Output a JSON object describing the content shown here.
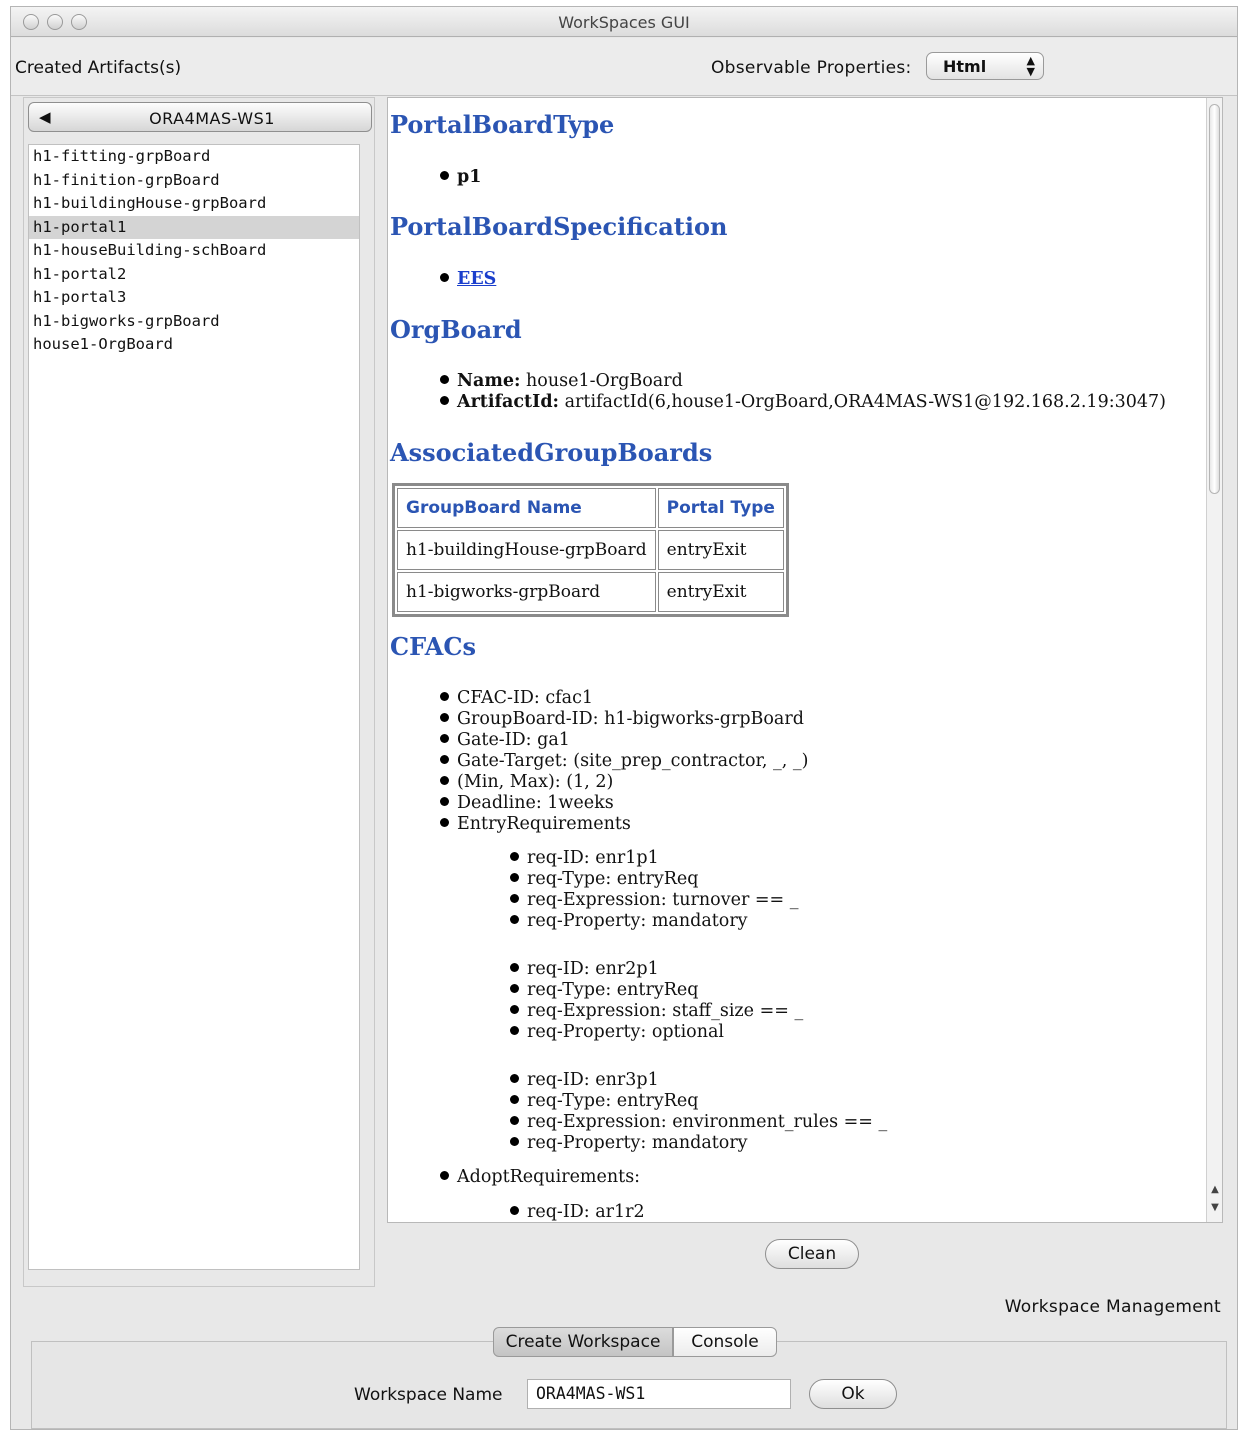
{
  "window": {
    "title": "WorkSpaces GUI"
  },
  "toolbar": {
    "created_label": "Created Artifacts(s)",
    "observable_label": "Observable Properties:",
    "format_value": "Html"
  },
  "left": {
    "workspace_button": "ORA4MAS-WS1",
    "artifacts": [
      "h1-fitting-grpBoard",
      "h1-finition-grpBoard",
      "h1-buildingHouse-grpBoard",
      "h1-portal1",
      "h1-houseBuilding-schBoard",
      "h1-portal2",
      "h1-portal3",
      "h1-bigworks-grpBoard",
      "house1-OrgBoard"
    ],
    "selected_index": 3
  },
  "content": {
    "portal_board_type": {
      "heading": "PortalBoardType",
      "value": "p1"
    },
    "portal_board_spec": {
      "heading": "PortalBoardSpecification",
      "link": "EES"
    },
    "org_board": {
      "heading": "OrgBoard",
      "name_key": "Name:",
      "name_value": "house1-OrgBoard",
      "artifact_key": "ArtifactId:",
      "artifact_value": "artifactId(6,house1-OrgBoard,ORA4MAS-WS1@192.168.2.19:3047)"
    },
    "assoc": {
      "heading": "AssociatedGroupBoards",
      "headers": [
        "GroupBoard Name",
        "Portal Type"
      ],
      "rows": [
        [
          "h1-buildingHouse-grpBoard",
          "entryExit"
        ],
        [
          "h1-bigworks-grpBoard",
          "entryExit"
        ]
      ]
    },
    "cfacs": {
      "heading": "CFACs",
      "items": [
        "CFAC-ID: cfac1",
        "GroupBoard-ID: h1-bigworks-grpBoard",
        "Gate-ID: ga1",
        "Gate-Target: (site_prep_contractor, _, _)",
        "(Min, Max): (1, 2)",
        "Deadline: 1weeks",
        "EntryRequirements"
      ],
      "req_group_1": [
        "req-ID: enr1p1",
        "req-Type: entryReq",
        "req-Expression: turnover == _",
        "req-Property: mandatory"
      ],
      "req_group_2": [
        "req-ID: enr2p1",
        "req-Type: entryReq",
        "req-Expression: staff_size == _",
        "req-Property: optional"
      ],
      "req_group_3": [
        "req-ID: enr3p1",
        "req-Type: entryReq",
        "req-Expression: environment_rules == _",
        "req-Property: mandatory"
      ],
      "adopt": "AdoptRequirements:",
      "adopt_first": "req-ID: ar1r2"
    },
    "clean_button": "Clean"
  },
  "workspace": {
    "section_label": "Workspace Management",
    "tabs": [
      "Create Workspace",
      "Console"
    ],
    "name_label": "Workspace Name",
    "name_value": "ORA4MAS-WS1",
    "ok_button": "Ok"
  }
}
